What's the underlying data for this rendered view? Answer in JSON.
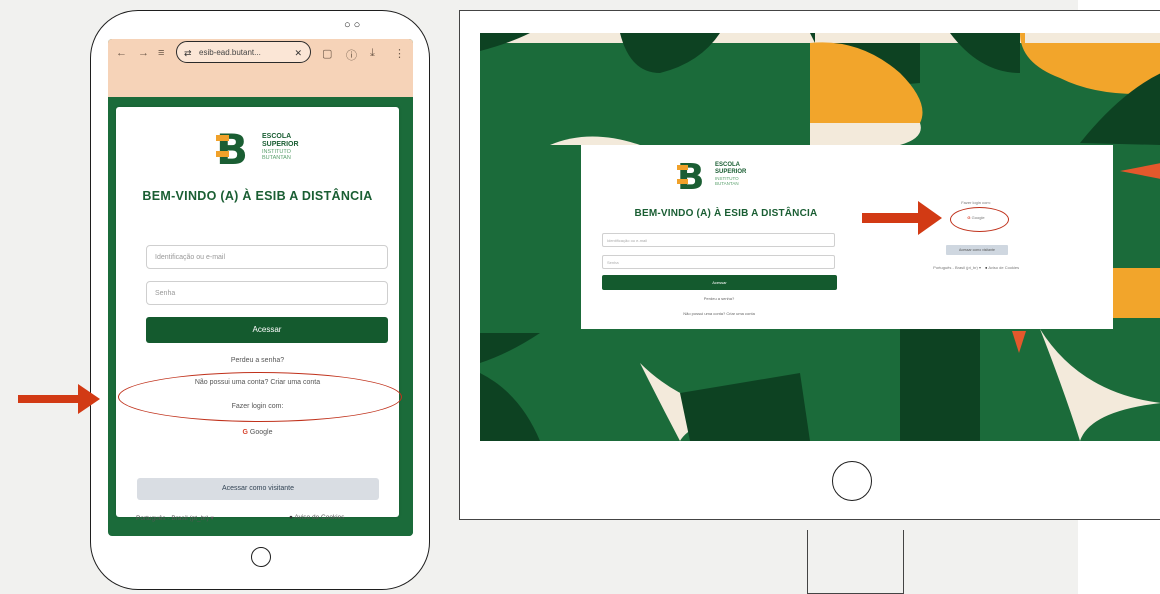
{
  "brand": {
    "line1": "ESCOLA",
    "line2": "SUPERIOR",
    "line3": "INSTITUTO",
    "line4": "BUTANTAN",
    "colors": {
      "green": "#1a5e33",
      "orange": "#f0a12a",
      "accent_red": "#d23a14"
    }
  },
  "mobile": {
    "url": "esib-ead.butant...",
    "title": "BEM-VINDO (A) À ESIB A DISTÂNCIA",
    "username_placeholder": "Identificação ou e-mail",
    "password_placeholder": "Senha",
    "login_button": "Acessar",
    "forgot_password": "Perdeu a senha?",
    "no_account": "Não possui uma conta? Criar uma conta",
    "login_with": "Fazer login com:",
    "google_button": "Google",
    "guest_button": "Acessar como visitante",
    "language": "Português - Brasil (pt_br)",
    "cookies_notice": "Aviso de Cookies"
  },
  "desktop": {
    "title": "BEM-VINDO (A) À ESIB A DISTÂNCIA",
    "username_placeholder": "Identificação ou e-mail",
    "password_placeholder": "Senha",
    "login_button": "Acessar",
    "forgot_password": "Perdeu a senha?",
    "no_account": "Não possui uma conta? Criar uma conta",
    "login_with": "Fazer login com:",
    "google_button": "Google",
    "guest_button": "Acessar como visitante",
    "language": "Português - Brasil (pt_br)",
    "cookies_notice": "Aviso de Cookies"
  }
}
